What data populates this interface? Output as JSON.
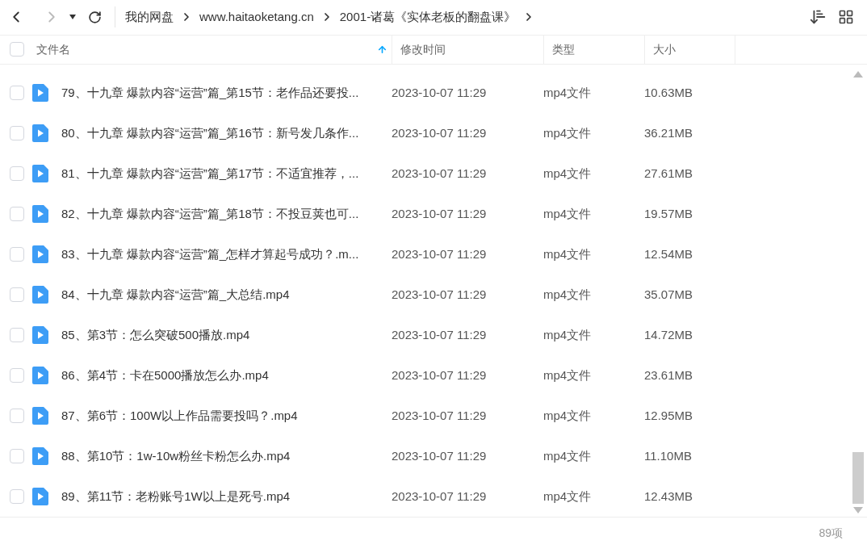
{
  "nav": {
    "breadcrumbs": [
      "我的网盘",
      "www.haitaoketang.cn",
      "2001-诸葛《实体老板的翻盘课》"
    ]
  },
  "table": {
    "select_all": {
      "checked": false
    },
    "columns": [
      {
        "label": "文件名",
        "sorted": true
      },
      {
        "label": "修改时间",
        "sorted": false
      },
      {
        "label": "类型",
        "sorted": false
      },
      {
        "label": "大小",
        "sorted": false
      }
    ],
    "rows": [
      {
        "name": "79、十九章 爆款内容“运营”篇_第15节：老作品还要投...",
        "modified": "2023-10-07 11:29",
        "type": "mp4文件",
        "size": "10.63MB",
        "checked": false
      },
      {
        "name": "80、十九章 爆款内容“运营”篇_第16节：新号发几条作...",
        "modified": "2023-10-07 11:29",
        "type": "mp4文件",
        "size": "36.21MB",
        "checked": false
      },
      {
        "name": "81、十九章 爆款内容“运营”篇_第17节：不适宜推荐，...",
        "modified": "2023-10-07 11:29",
        "type": "mp4文件",
        "size": "27.61MB",
        "checked": false
      },
      {
        "name": "82、十九章 爆款内容“运营”篇_第18节：不投豆荚也可...",
        "modified": "2023-10-07 11:29",
        "type": "mp4文件",
        "size": "19.57MB",
        "checked": false
      },
      {
        "name": "83、十九章 爆款内容“运营”篇_怎样才算起号成功？.m...",
        "modified": "2023-10-07 11:29",
        "type": "mp4文件",
        "size": "12.54MB",
        "checked": false
      },
      {
        "name": "84、十九章 爆款内容“运营”篇_大总结.mp4",
        "modified": "2023-10-07 11:29",
        "type": "mp4文件",
        "size": "35.07MB",
        "checked": false
      },
      {
        "name": "85、第3节：怎么突破500播放.mp4",
        "modified": "2023-10-07 11:29",
        "type": "mp4文件",
        "size": "14.72MB",
        "checked": false
      },
      {
        "name": "86、第4节：卡在5000播放怎么办.mp4",
        "modified": "2023-10-07 11:29",
        "type": "mp4文件",
        "size": "23.61MB",
        "checked": false
      },
      {
        "name": "87、第6节：100W以上作品需要投吗？.mp4",
        "modified": "2023-10-07 11:29",
        "type": "mp4文件",
        "size": "12.95MB",
        "checked": false
      },
      {
        "name": "88、第10节：1w-10w粉丝卡粉怎么办.mp4",
        "modified": "2023-10-07 11:29",
        "type": "mp4文件",
        "size": "11.10MB",
        "checked": false
      },
      {
        "name": "89、第11节：老粉账号1W以上是死号.mp4",
        "modified": "2023-10-07 11:29",
        "type": "mp4文件",
        "size": "12.43MB",
        "checked": false
      }
    ]
  },
  "status_bar": {
    "count": "89项"
  }
}
